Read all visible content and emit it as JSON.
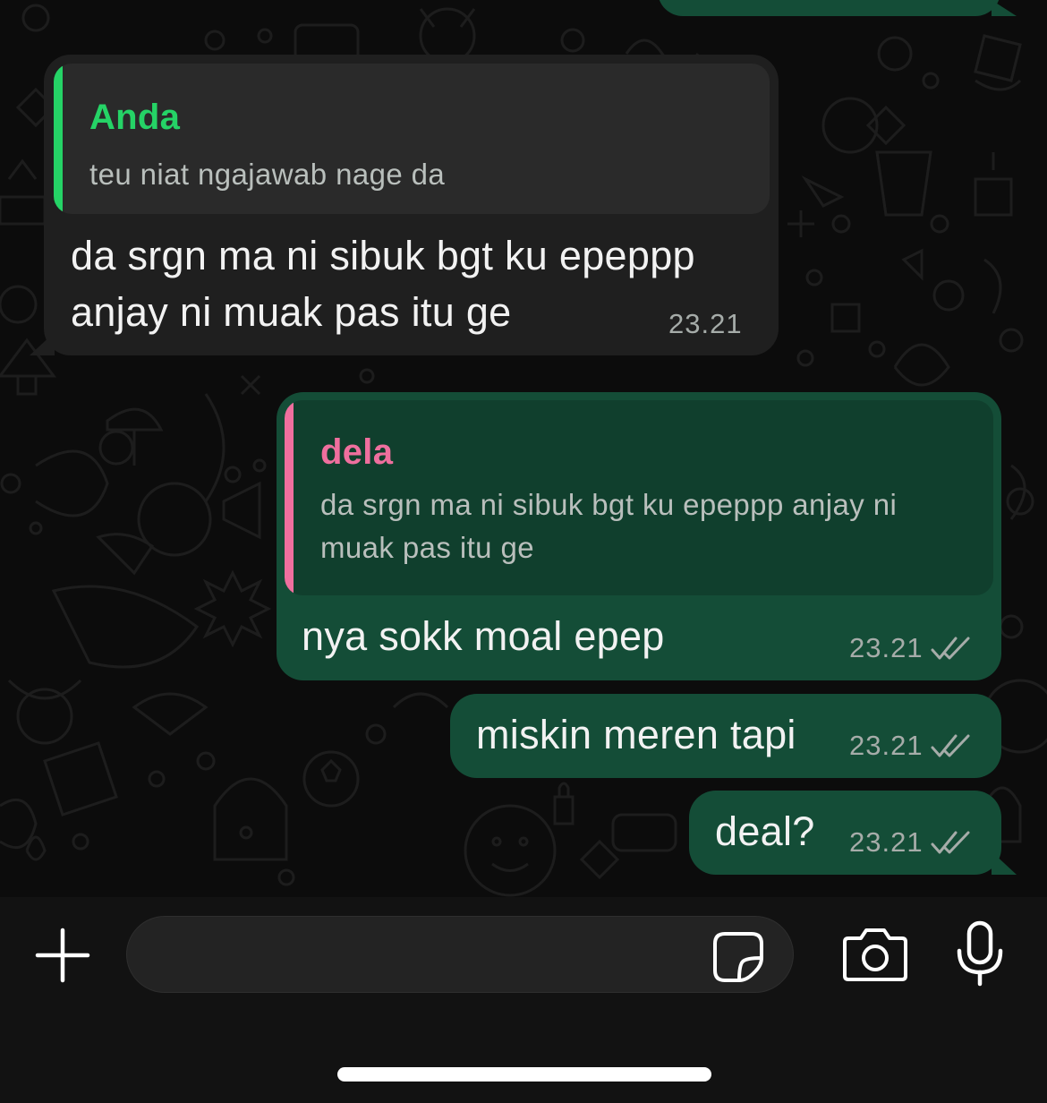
{
  "colors": {
    "incoming_bubble": "#1f1f1f",
    "outgoing_bubble": "#144d37",
    "quote_self_accent": "#25d366",
    "quote_other_accent": "#ef6f9e",
    "read_ticks": "#a6aca9"
  },
  "messages": [
    {
      "direction": "incoming",
      "quote": {
        "author": "Anda",
        "text": "teu niat ngajawab nage da"
      },
      "text_line1": "da srgn ma ni sibuk bgt ku epeppp",
      "text_line2": "anjay ni muak pas itu ge",
      "time": "23.21"
    },
    {
      "direction": "outgoing",
      "quote": {
        "author": "dela",
        "text_line1": "da srgn ma ni sibuk bgt ku epeppp anjay ni",
        "text_line2": "muak pas itu ge"
      },
      "text": "nya sokk moal epep",
      "time": "23.21",
      "status": "read"
    },
    {
      "direction": "outgoing",
      "text": "miskin meren tapi",
      "time": "23.21",
      "status": "read"
    },
    {
      "direction": "outgoing",
      "text": "deal?",
      "time": "23.21",
      "status": "read"
    }
  ],
  "composer": {
    "placeholder": "",
    "icons": {
      "attach": "plus-icon",
      "sticker": "sticker-icon",
      "camera": "camera-icon",
      "voice": "microphone-icon"
    }
  }
}
